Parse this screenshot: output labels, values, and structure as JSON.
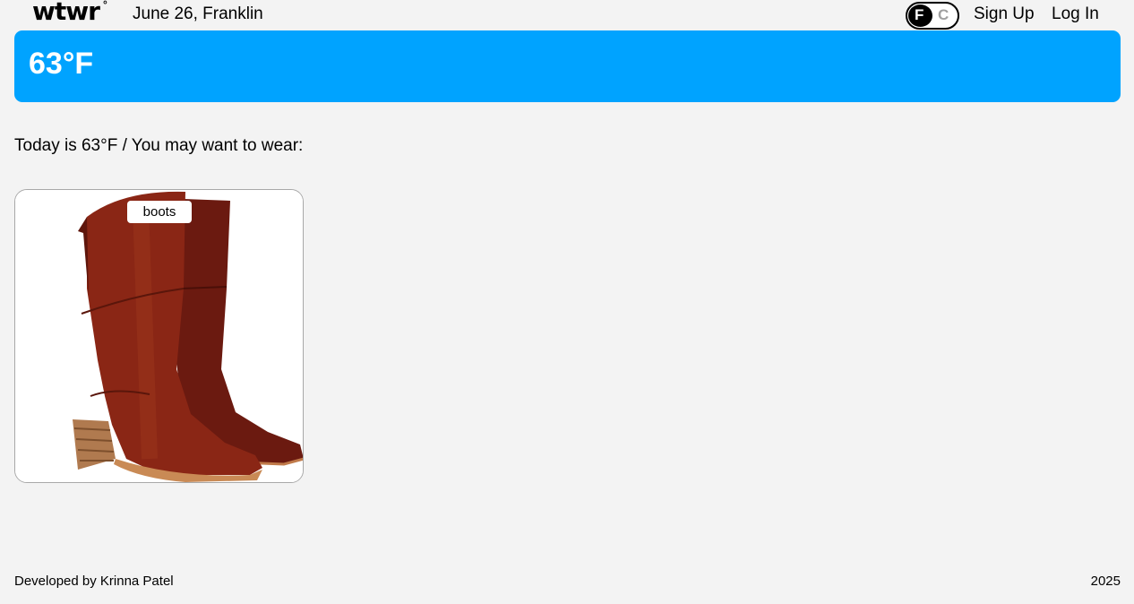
{
  "header": {
    "logo": "wtwr",
    "logo_degree": "°",
    "date_location": "June 26, Franklin",
    "toggle": {
      "fahrenheit": "F",
      "celsius": "C",
      "selected": "F"
    },
    "signup_label": "Sign Up",
    "login_label": "Log In"
  },
  "weather": {
    "temperature": "63°F",
    "banner_color": "#00a3ff"
  },
  "main": {
    "suggestion_text": "Today is 63°F / You may want to wear:",
    "items": [
      {
        "name": "boots"
      }
    ]
  },
  "footer": {
    "developer": "Developed by Krinna Patel",
    "year": "2025"
  }
}
